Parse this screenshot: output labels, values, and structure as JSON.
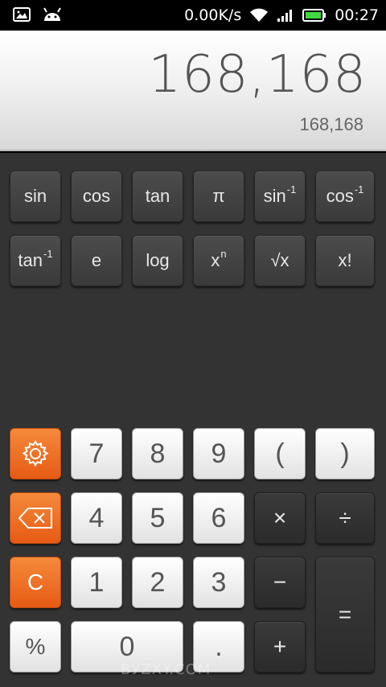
{
  "statusbar": {
    "speed": "0.00K/s",
    "time": "00:27",
    "battery_color": "#3fd83f"
  },
  "display": {
    "main_value": "168,168",
    "sub_value": "168,168"
  },
  "scientific": {
    "row1": [
      "sin",
      "cos",
      "tan",
      "π",
      "sin",
      "cos"
    ],
    "row1_sup": [
      "",
      "",
      "",
      "",
      "-1",
      "-1"
    ],
    "row2": [
      "tan",
      "e",
      "log",
      "x",
      "√x",
      "x!"
    ],
    "row2_sup": [
      "-1",
      "",
      "",
      "n",
      "",
      ""
    ]
  },
  "keys": {
    "seven": "7",
    "eight": "8",
    "nine": "9",
    "lparen": "(",
    "rparen": ")",
    "four": "4",
    "five": "5",
    "six": "6",
    "multiply": "×",
    "divide": "÷",
    "clear": "C",
    "one": "1",
    "two": "2",
    "three": "3",
    "minus": "−",
    "equals": "=",
    "percent": "%",
    "zero": "0",
    "dot": ".",
    "plus": "+"
  },
  "colors": {
    "accent_orange": "#ef6f23",
    "display_text": "#555555",
    "keypad_bg": "#333333"
  },
  "watermark": "ВУZХY.COM"
}
